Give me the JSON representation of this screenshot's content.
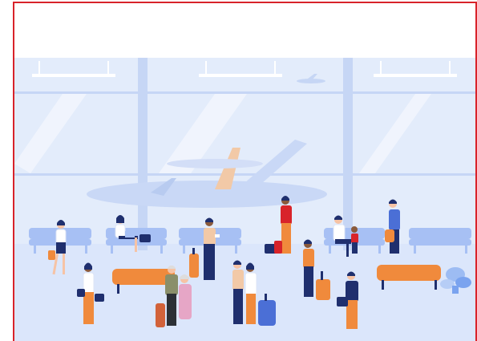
{
  "illustration": {
    "subject": "airport-terminal-waiting-area",
    "colors": {
      "frame": "#d8232a",
      "window": "#e3ecfb",
      "floor": "#dbe6fb",
      "column": "#c6d6f5",
      "seat": "#a7c0f4",
      "bench": "#f08a3c",
      "navy": "#1f2f6e",
      "orange": "#f08a3c",
      "skin_light": "#f6c3a5",
      "skin_dark": "#8a5a3c"
    },
    "icons": [
      "airplane-icon",
      "plant-icon",
      "suitcase-icon"
    ]
  }
}
